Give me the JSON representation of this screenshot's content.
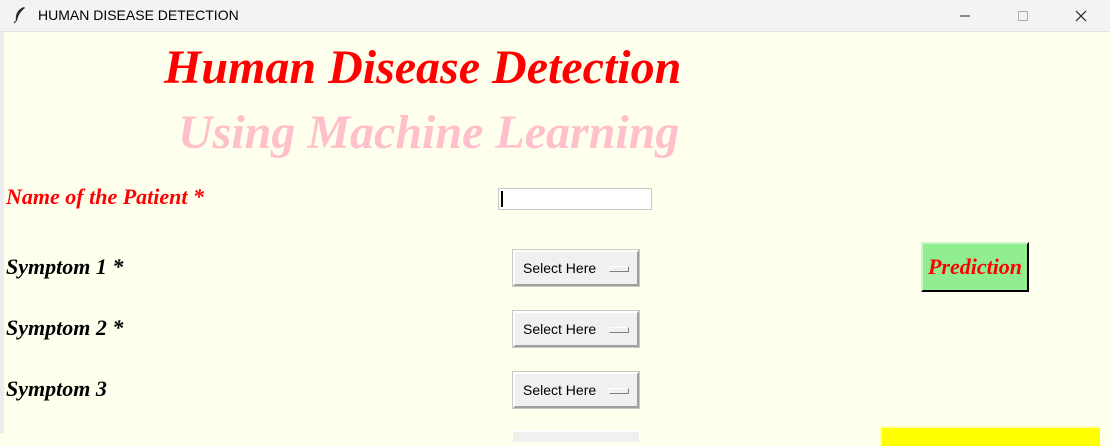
{
  "window": {
    "title": "HUMAN DISEASE DETECTION"
  },
  "header": {
    "title": "Human Disease Detection",
    "subtitle": "Using Machine Learning"
  },
  "form": {
    "name_label": "Name of the Patient *",
    "name_value": "",
    "symptom1_label": "Symptom 1 *",
    "symptom2_label": "Symptom 2 *",
    "symptom3_label": "Symptom 3",
    "symptom1_value": "Select Here",
    "symptom2_value": "Select Here",
    "symptom3_value": "Select Here"
  },
  "actions": {
    "prediction_label": "Prediction"
  },
  "colors": {
    "background": "#ffffee",
    "title": "#ff0000",
    "subtitle": "#ffc0cb",
    "prediction_bg": "#90ee90",
    "lower_button_bg": "#ffff00"
  }
}
